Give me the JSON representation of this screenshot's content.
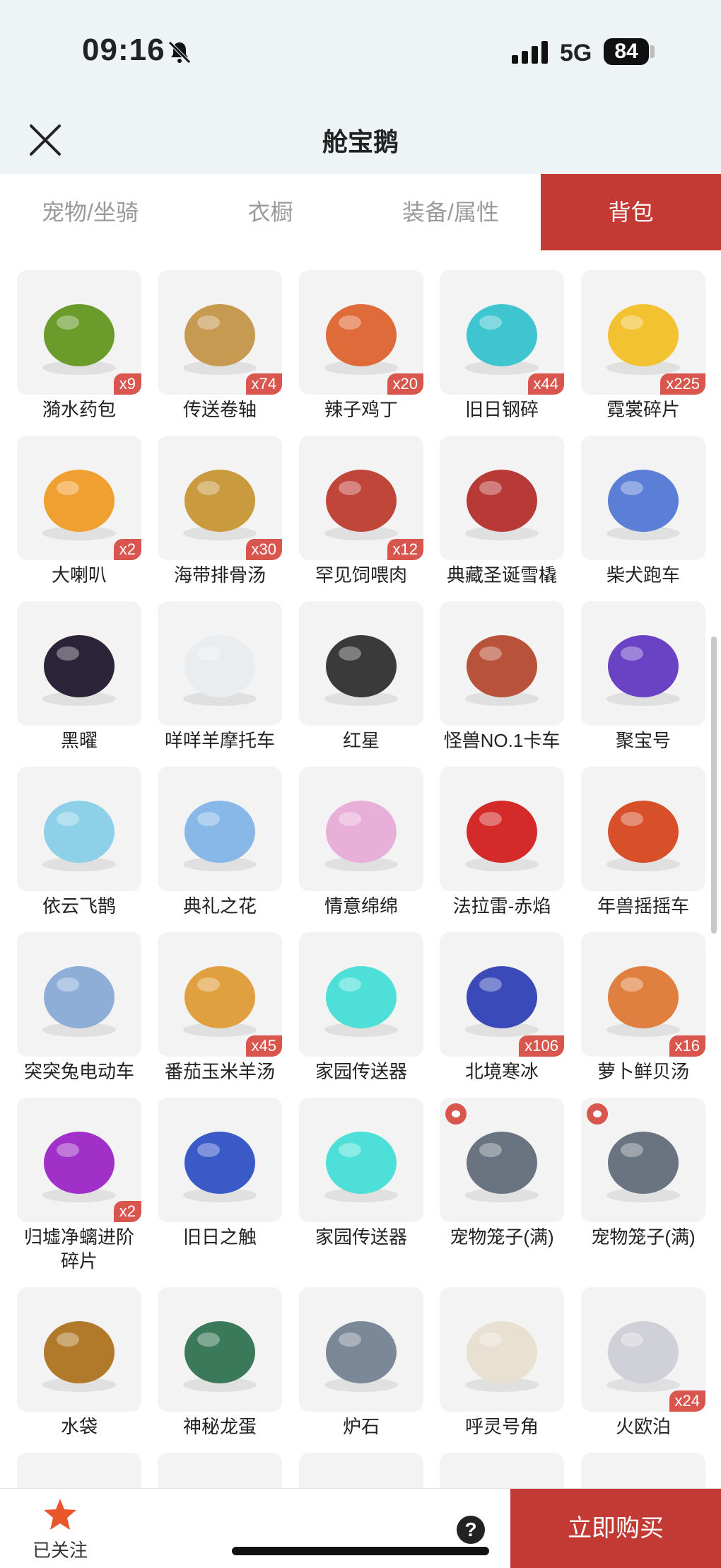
{
  "status_bar": {
    "time": "09:16",
    "network": "5G",
    "battery": "84"
  },
  "header": {
    "title": "舱宝鹅"
  },
  "tabs": [
    {
      "label": "宠物/坐骑",
      "active": false
    },
    {
      "label": "衣橱",
      "active": false
    },
    {
      "label": "装备/属性",
      "active": false
    },
    {
      "label": "背包",
      "active": true
    }
  ],
  "items": [
    {
      "name": "漪水药包",
      "qty": "x9",
      "color": "#6a9b2b"
    },
    {
      "name": "传送卷轴",
      "qty": "x74",
      "color": "#c79a52"
    },
    {
      "name": "辣子鸡丁",
      "qty": "x20",
      "color": "#e06b3a"
    },
    {
      "name": "旧日钢碎",
      "qty": "x44",
      "color": "#3fc5cf"
    },
    {
      "name": "霓裳碎片",
      "qty": "x225",
      "color": "#f2c230"
    },
    {
      "name": "大喇叭",
      "qty": "x2",
      "color": "#f0a030"
    },
    {
      "name": "海带排骨汤",
      "qty": "x30",
      "color": "#c99a3e"
    },
    {
      "name": "罕见饲喂肉",
      "qty": "x12",
      "color": "#c0463a"
    },
    {
      "name": "典藏圣诞雪橇",
      "qty": "",
      "color": "#b83a36"
    },
    {
      "name": "柴犬跑车",
      "qty": "",
      "color": "#5b7fd6"
    },
    {
      "name": "黑曜",
      "qty": "",
      "color": "#2b2438"
    },
    {
      "name": "咩咩羊摩托车",
      "qty": "",
      "color": "#e9edf0"
    },
    {
      "name": "红星",
      "qty": "",
      "color": "#3a3a3a"
    },
    {
      "name": "怪兽NO.1卡车",
      "qty": "",
      "color": "#b8523a"
    },
    {
      "name": "聚宝号",
      "qty": "",
      "color": "#6a42c4"
    },
    {
      "name": "依云飞鹊",
      "qty": "",
      "color": "#8ed0e8"
    },
    {
      "name": "典礼之花",
      "qty": "",
      "color": "#88b8e8"
    },
    {
      "name": "情意绵绵",
      "qty": "",
      "color": "#e8b0d8"
    },
    {
      "name": "法拉雷-赤焰",
      "qty": "",
      "color": "#d42a2a"
    },
    {
      "name": "年兽摇摇车",
      "qty": "",
      "color": "#d8502a"
    },
    {
      "name": "突突兔电动车",
      "qty": "",
      "color": "#8eaed8"
    },
    {
      "name": "番茄玉米羊汤",
      "qty": "x45",
      "color": "#e0a040"
    },
    {
      "name": "家园传送器",
      "qty": "",
      "color": "#4ee0d8"
    },
    {
      "name": "北境寒冰",
      "qty": "x106",
      "color": "#3a4ab8"
    },
    {
      "name": "萝卜鲜贝汤",
      "qty": "x16",
      "color": "#e08040"
    },
    {
      "name": "归墟净螭进阶碎片",
      "qty": "x2",
      "color": "#a030c8"
    },
    {
      "name": "旧日之触",
      "qty": "",
      "color": "#3a5ac8"
    },
    {
      "name": "家园传送器",
      "qty": "",
      "color": "#4ee0d8"
    },
    {
      "name": "宠物笼子(满)",
      "qty": "",
      "color": "#6a7480",
      "paw": true
    },
    {
      "name": "宠物笼子(满)",
      "qty": "",
      "color": "#6a7480",
      "paw": true
    },
    {
      "name": "水袋",
      "qty": "",
      "color": "#b07a2a"
    },
    {
      "name": "神秘龙蛋",
      "qty": "",
      "color": "#3a7a5a"
    },
    {
      "name": "炉石",
      "qty": "",
      "color": "#7a8898"
    },
    {
      "name": "呼灵号角",
      "qty": "",
      "color": "#e8e0d0"
    },
    {
      "name": "火欧泊",
      "qty": "x24",
      "color": "#d0d0d8"
    }
  ],
  "bottom_bar": {
    "follow_label": "已关注",
    "help": "?",
    "buy_label": "立即购买"
  }
}
